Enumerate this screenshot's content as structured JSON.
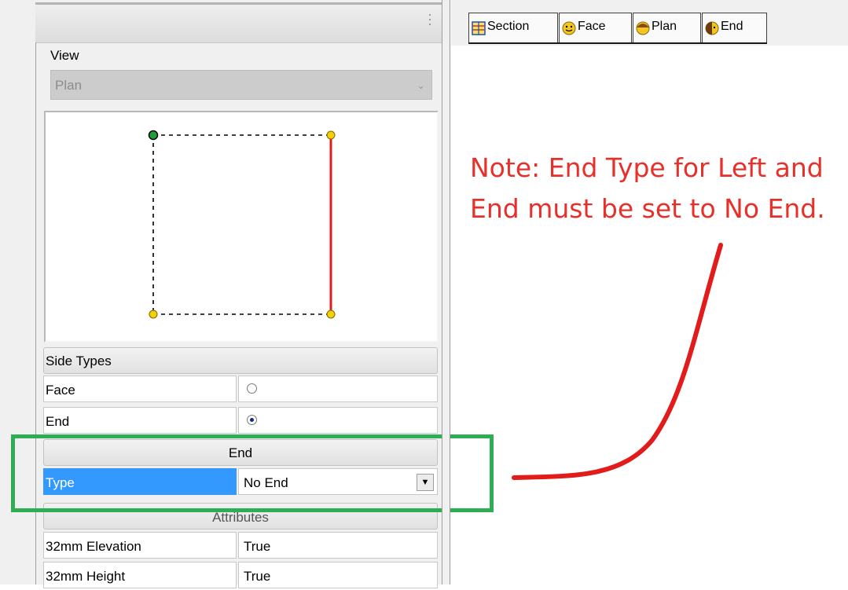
{
  "left_panel": {
    "view_label": "View",
    "view_select": {
      "value": "Plan"
    },
    "side_types": {
      "header": "Side Types",
      "rows": [
        {
          "label": "Face",
          "selected": false
        },
        {
          "label": "End",
          "selected": true
        }
      ]
    },
    "end_section": {
      "header": "End",
      "type_label": "Type",
      "type_value": "No End"
    },
    "attributes": {
      "header": "Attributes",
      "rows": [
        {
          "label": "32mm Elevation",
          "value": "True"
        },
        {
          "label": "32mm Height",
          "value": "True"
        }
      ]
    }
  },
  "tabs": [
    {
      "label": "Section",
      "icon": "section-icon"
    },
    {
      "label": "Face",
      "icon": "face-icon"
    },
    {
      "label": "Plan",
      "icon": "plan-icon"
    },
    {
      "label": "End",
      "icon": "end-icon"
    }
  ],
  "annotation": {
    "line1": "Note: End Type for Left and",
    "line2": "End must be set to No End.",
    "color": "#e8302a",
    "highlight_color": "#2ead55"
  },
  "colors": {
    "selected_row": "#3399ff",
    "active_side": "#e21b1b",
    "corner_node": "#f5d000",
    "origin_node": "#1f9d3a"
  }
}
